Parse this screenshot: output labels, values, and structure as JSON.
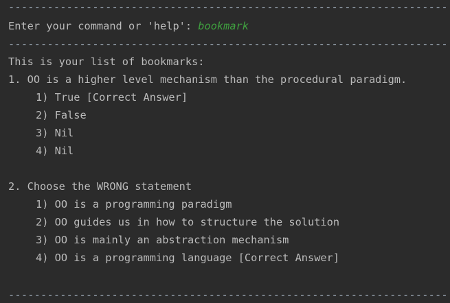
{
  "separator": "--------------------------------------------------------------------",
  "prompt": {
    "label": "Enter your command or 'help': ",
    "input": "bookmark"
  },
  "header": "This is your list of bookmarks:",
  "questions": [
    {
      "text": "1. OO is a higher level mechanism than the procedural paradigm.",
      "options": [
        "1) True [Correct Answer]",
        "2) False",
        "3) Nil",
        "4) Nil"
      ]
    },
    {
      "text": "2. Choose the WRONG statement",
      "options": [
        "1) OO is a programming paradigm",
        "2) OO guides us in how to structure the solution",
        "3) OO is mainly an abstraction mechanism",
        "4) OO is a programming language [Correct Answer]"
      ]
    }
  ],
  "colors": {
    "background": "#2b2b2b",
    "text": "#bbbbbb",
    "user_input": "#3f9f3f"
  }
}
